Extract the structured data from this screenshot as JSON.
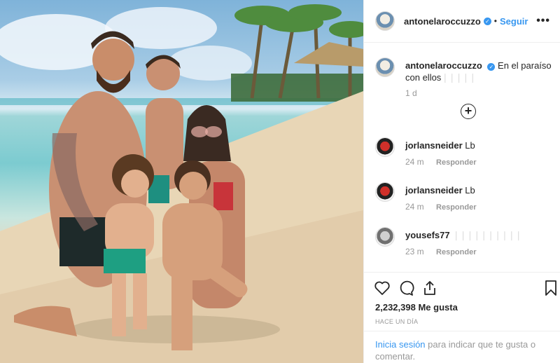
{
  "header": {
    "username": "antonelaroccuzzo",
    "verified_mark": "✓",
    "dot": "•",
    "follow_label": "Seguir",
    "more_label": "•••"
  },
  "caption": {
    "username": "antonelaroccuzzo",
    "text": "En el paraíso con ellos",
    "emoji_placeholder": "❘❘❘❘❘",
    "time": "1 d"
  },
  "load_more_label": "+",
  "comments": [
    {
      "username": "jorlansneider",
      "text": "Lb",
      "time": "24 m",
      "reply_label": "Responder"
    },
    {
      "username": "jorlansneider",
      "text": "Lb",
      "time": "24 m",
      "reply_label": "Responder"
    },
    {
      "username": "yousefs77",
      "text": "❘❘❘❘❘❘❘❘❘❘",
      "time": "23 m",
      "reply_label": "Responder"
    }
  ],
  "actions": {
    "likes_count": "2,232,398",
    "likes_label": "Me gusta",
    "posted_ago": "HACE UN DÍA",
    "login_link": "Inicia sesión",
    "login_text": " para indicar que te gusta o comentar."
  },
  "icons": [
    "heart-icon",
    "comment-icon",
    "share-icon",
    "bookmark-icon"
  ],
  "colors": {
    "accent": "#3897f0",
    "text": "#262626",
    "muted": "#999999"
  }
}
